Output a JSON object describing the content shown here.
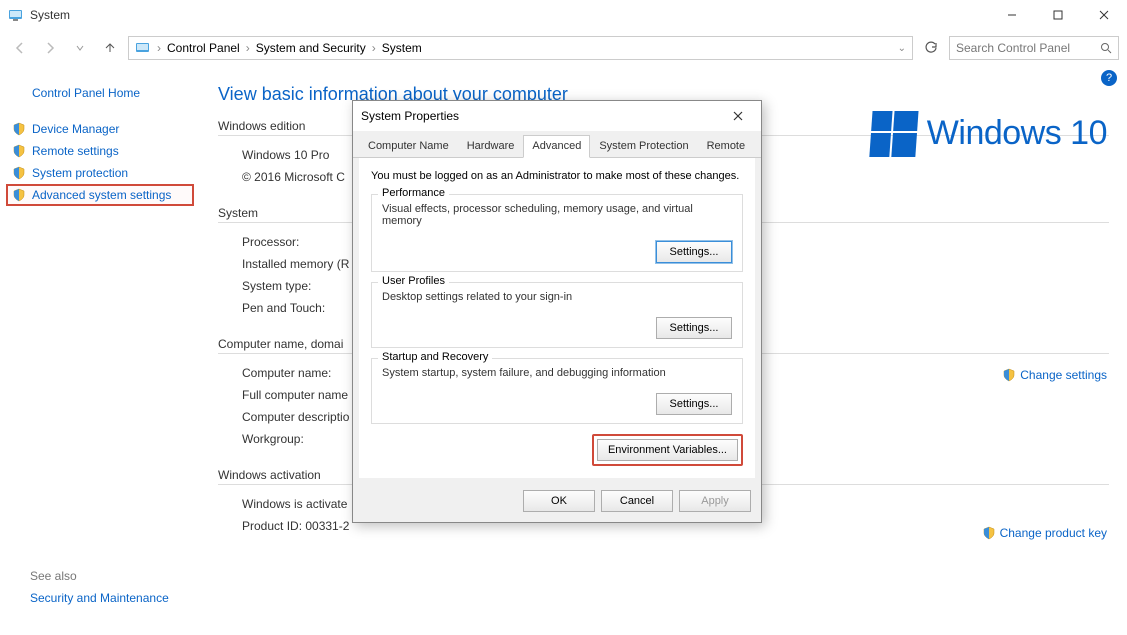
{
  "titlebar": {
    "title": "System"
  },
  "breadcrumb": {
    "a": "Control Panel",
    "b": "System and Security",
    "c": "System"
  },
  "search": {
    "placeholder": "Search Control Panel"
  },
  "sidebar": {
    "home": "Control Panel Home",
    "items": [
      {
        "label": "Device Manager"
      },
      {
        "label": "Remote settings"
      },
      {
        "label": "System protection"
      },
      {
        "label": "Advanced system settings"
      }
    ],
    "seealso_label": "See also",
    "seealso_link": "Security and Maintenance"
  },
  "main": {
    "heading": "View basic information about your computer",
    "edition": {
      "title": "Windows edition",
      "line1": "Windows 10 Pro",
      "line2": "© 2016 Microsoft C"
    },
    "system": {
      "title": "System",
      "r1": "Processor:",
      "r2": "Installed memory (R",
      "r3": "System type:",
      "r4": "Pen and Touch:"
    },
    "cnd": {
      "title": "Computer name, domai",
      "r1": "Computer name:",
      "r2": "Full computer name",
      "r3": "Computer descriptio",
      "r4": "Workgroup:"
    },
    "activation": {
      "title": "Windows activation",
      "r1": "Windows is activate",
      "r2": "Product ID: 00331-2"
    },
    "winlogo_text": "Windows 10",
    "change_settings": "Change settings",
    "change_product_key": "Change product key"
  },
  "dialog": {
    "title": "System Properties",
    "tabs": {
      "t1": "Computer Name",
      "t2": "Hardware",
      "t3": "Advanced",
      "t4": "System Protection",
      "t5": "Remote"
    },
    "note": "You must be logged on as an Administrator to make most of these changes.",
    "perf": {
      "label": "Performance",
      "text": "Visual effects, processor scheduling, memory usage, and virtual memory",
      "btn": "Settings..."
    },
    "profiles": {
      "label": "User Profiles",
      "text": "Desktop settings related to your sign-in",
      "btn": "Settings..."
    },
    "startup": {
      "label": "Startup and Recovery",
      "text": "System startup, system failure, and debugging information",
      "btn": "Settings..."
    },
    "env_btn": "Environment Variables...",
    "ok": "OK",
    "cancel": "Cancel",
    "apply": "Apply"
  }
}
